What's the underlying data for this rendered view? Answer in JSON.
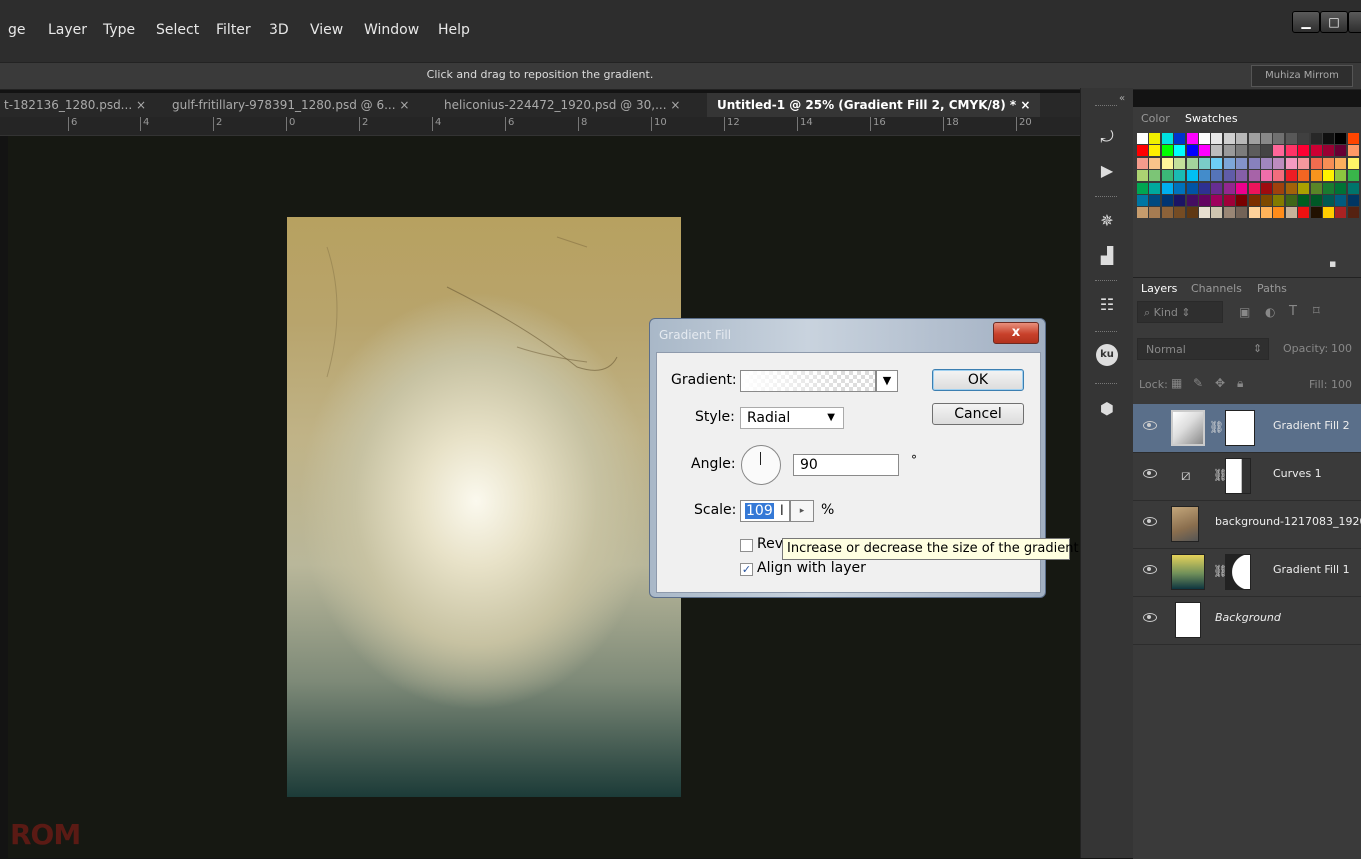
{
  "menu": {
    "items": [
      "ge",
      "Layer",
      "Type",
      "Select",
      "Filter",
      "3D",
      "View",
      "Window",
      "Help"
    ]
  },
  "window_controls": {
    "minimize": "▁",
    "maximize": "□"
  },
  "options_bar": {
    "hint": "Click and drag to reposition the gradient.",
    "workspace": "Muhiza Mirrom"
  },
  "tabs": [
    {
      "label": "t-182136_1280.psd...",
      "close": "×"
    },
    {
      "label": "gulf-fritillary-978391_1280.psd @ 6...",
      "close": "×"
    },
    {
      "label": "heliconius-224472_1920.psd @ 30,...",
      "close": "×"
    },
    {
      "label": "Untitled-1 @ 25% (Gradient Fill 2, CMYK/8) *",
      "close": "×"
    }
  ],
  "ruler": {
    "labels": [
      "6",
      "4",
      "2",
      "0",
      "2",
      "4",
      "6",
      "8",
      "10",
      "12",
      "14",
      "16",
      "18",
      "20"
    ]
  },
  "watermark": "ROM",
  "swatches_panel": {
    "tabs": [
      "Color",
      "Swatches"
    ],
    "collapse": "«",
    "new_swatch_icon": "new-swatch-icon"
  },
  "layers_panel": {
    "tabs": [
      "Layers",
      "Channels",
      "Paths"
    ],
    "filter_kind": "Kind",
    "blend_mode": "Normal",
    "opacity_label": "Opacity:",
    "opacity_value": "100",
    "lock_label": "Lock:",
    "fill_label": "Fill:",
    "fill_value": "100",
    "layers": [
      {
        "name": "Gradient Fill 2",
        "selected": true
      },
      {
        "name": "Curves 1",
        "selected": false
      },
      {
        "name": "background-1217083_1920",
        "selected": false
      },
      {
        "name": "Gradient Fill 1",
        "selected": false
      },
      {
        "name": "Background",
        "selected": false
      }
    ]
  },
  "dialog": {
    "title": "Gradient Fill",
    "close": "x",
    "gradient_label": "Gradient:",
    "style_label": "Style:",
    "style_value": "Radial",
    "angle_label": "Angle:",
    "angle_value": "90",
    "degree_symbol": "°",
    "scale_label": "Scale:",
    "scale_value": "109",
    "percent_symbol": "%",
    "reverse_label": "Rev",
    "reverse_checked": false,
    "align_label": "Align with layer",
    "align_checked": true,
    "ok_label": "OK",
    "cancel_label": "Cancel"
  },
  "tooltip": "Increase or decrease the size of the gradient",
  "colors": {
    "selected_layer": "#5a6f8a",
    "panel_bg": "#3a3a3a",
    "tooltip_bg": "#ffffe1"
  }
}
